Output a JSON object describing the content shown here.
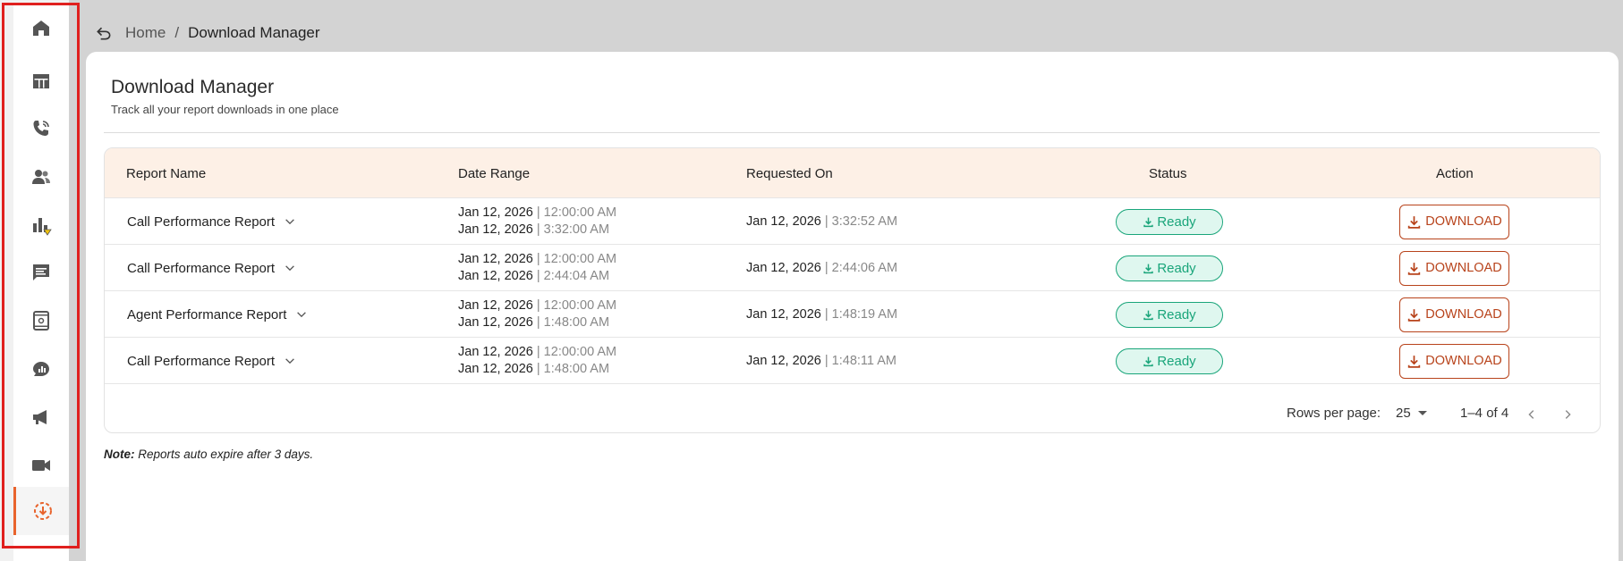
{
  "breadcrumb": {
    "home": "Home",
    "separator": "/",
    "current": "Download Manager"
  },
  "page": {
    "title": "Download Manager",
    "subtitle": "Track all your report downloads in one place"
  },
  "sidebar": {
    "items": [
      {
        "icon": "home-icon"
      },
      {
        "icon": "table-icon"
      },
      {
        "icon": "phone-icon"
      },
      {
        "icon": "users-icon"
      },
      {
        "icon": "bar-chart-icon"
      },
      {
        "icon": "chat-icon"
      },
      {
        "icon": "tablet-icon"
      },
      {
        "icon": "chat-analytics-icon"
      },
      {
        "icon": "megaphone-icon"
      },
      {
        "icon": "video-icon"
      },
      {
        "icon": "download-manager-icon",
        "active": true
      }
    ],
    "highlight_color": "#e0201e",
    "active_color": "#e8632c"
  },
  "table": {
    "headers": {
      "report_name": "Report Name",
      "date_range": "Date Range",
      "requested_on": "Requested On",
      "status": "Status",
      "action": "Action"
    },
    "rows": [
      {
        "name": "Call Performance Report",
        "from_date": "Jan 12, 2026",
        "from_time": "| 12:00:00 AM",
        "to_date": "Jan 12, 2026",
        "to_time": "| 3:32:00 AM",
        "req_date": "Jan 12, 2026",
        "req_time": "| 3:32:52 AM",
        "status": "Ready",
        "action": "DOWNLOAD"
      },
      {
        "name": "Call Performance Report",
        "from_date": "Jan 12, 2026",
        "from_time": "| 12:00:00 AM",
        "to_date": "Jan 12, 2026",
        "to_time": "| 2:44:04 AM",
        "req_date": "Jan 12, 2026",
        "req_time": "| 2:44:06 AM",
        "status": "Ready",
        "action": "DOWNLOAD"
      },
      {
        "name": "Agent Performance Report",
        "from_date": "Jan 12, 2026",
        "from_time": "| 12:00:00 AM",
        "to_date": "Jan 12, 2026",
        "to_time": "| 1:48:00 AM",
        "req_date": "Jan 12, 2026",
        "req_time": "| 1:48:19 AM",
        "status": "Ready",
        "action": "DOWNLOAD"
      },
      {
        "name": "Call Performance Report",
        "from_date": "Jan 12, 2026",
        "from_time": "| 12:00:00 AM",
        "to_date": "Jan 12, 2026",
        "to_time": "| 1:48:00 AM",
        "req_date": "Jan 12, 2026",
        "req_time": "| 1:48:11 AM",
        "status": "Ready",
        "action": "DOWNLOAD"
      }
    ],
    "colors": {
      "header_bg": "#fdf0e6",
      "ready": "#19a57a",
      "download": "#b8431b"
    }
  },
  "pagination": {
    "rows_per_page_label": "Rows per page:",
    "rows_per_page_value": "25",
    "range": "1–4 of 4"
  },
  "note": {
    "label": "Note:",
    "text": "Reports auto expire after 3 days."
  }
}
